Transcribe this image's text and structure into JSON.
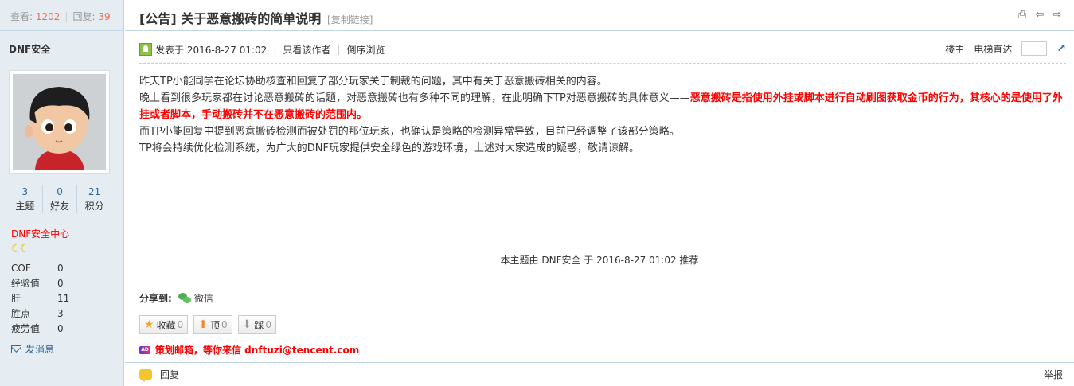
{
  "thread_stats": {
    "views_label": "查看:",
    "views": "1202",
    "replies_label": "回复:",
    "replies": "39"
  },
  "author": {
    "name": "DNF安全",
    "stats": [
      {
        "value": "3",
        "label": "主题"
      },
      {
        "value": "0",
        "label": "好友"
      },
      {
        "value": "21",
        "label": "积分"
      }
    ],
    "group": "DNF安全中心",
    "attrs": [
      {
        "key": "COF",
        "value": "0"
      },
      {
        "key": "经验值",
        "value": "0"
      },
      {
        "key": "肝",
        "value": "11"
      },
      {
        "key": "胜点",
        "value": "3"
      },
      {
        "key": "疲劳值",
        "value": "0"
      }
    ],
    "send_message": "发消息"
  },
  "thread": {
    "title": "[公告] 关于恶意搬砖的简单说明",
    "copy_link": "[复制链接]"
  },
  "post_info": {
    "posted_at": "发表于 2016-8-27 01:02",
    "only_author": "只看该作者",
    "reverse": "倒序浏览",
    "floor": "楼主",
    "jump_label": "电梯直达"
  },
  "content": {
    "p1": "昨天TP小能同学在论坛协助核查和回复了部分玩家关于制裁的问题，其中有关于恶意搬砖相关的内容。",
    "p2_normal": "晚上看到很多玩家都在讨论恶意搬砖的话题，对恶意搬砖也有多种不同的理解，在此明确下TP对恶意搬砖的具体意义——",
    "p2_red": "恶意搬砖是指使用外挂或脚本进行自动刷图获取金币的行为，其核心的是使用了外挂或者脚本，手动搬砖并不在恶意搬砖的范围内。",
    "p3": "而TP小能回复中提到恶意搬砖检测而被处罚的那位玩家，也确认是策略的检测异常导致，目前已经调整了该部分策略。",
    "p4": "TP将会持续优化检测系统，为广大的DNF玩家提供安全绿色的游戏环境，上述对大家造成的疑惑，敬请谅解。"
  },
  "recommend": "本主题由 DNF安全 于 2016-8-27 01:02 推荐",
  "share": {
    "label": "分享到:",
    "wechat": "微信"
  },
  "buttons": {
    "favorite": "收藏",
    "favorite_count": "0",
    "up": "顶",
    "up_count": "0",
    "down": "踩",
    "down_count": "0"
  },
  "ad": {
    "tag": "AD",
    "text": "策划邮箱，等你来信 dnftuzi@tencent.com"
  },
  "footer": {
    "reply": "回复",
    "report": "举报"
  }
}
